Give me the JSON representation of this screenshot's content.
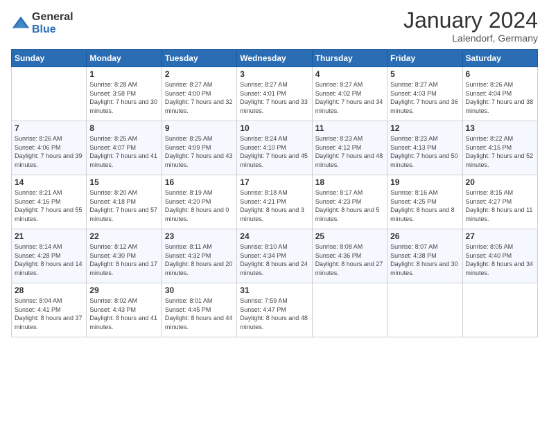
{
  "logo": {
    "general": "General",
    "blue": "Blue"
  },
  "header": {
    "month": "January 2024",
    "location": "Lalendorf, Germany"
  },
  "days_of_week": [
    "Sunday",
    "Monday",
    "Tuesday",
    "Wednesday",
    "Thursday",
    "Friday",
    "Saturday"
  ],
  "weeks": [
    [
      {
        "day": "",
        "sunrise": "",
        "sunset": "",
        "daylight": ""
      },
      {
        "day": "1",
        "sunrise": "Sunrise: 8:28 AM",
        "sunset": "Sunset: 3:58 PM",
        "daylight": "Daylight: 7 hours and 30 minutes."
      },
      {
        "day": "2",
        "sunrise": "Sunrise: 8:27 AM",
        "sunset": "Sunset: 4:00 PM",
        "daylight": "Daylight: 7 hours and 32 minutes."
      },
      {
        "day": "3",
        "sunrise": "Sunrise: 8:27 AM",
        "sunset": "Sunset: 4:01 PM",
        "daylight": "Daylight: 7 hours and 33 minutes."
      },
      {
        "day": "4",
        "sunrise": "Sunrise: 8:27 AM",
        "sunset": "Sunset: 4:02 PM",
        "daylight": "Daylight: 7 hours and 34 minutes."
      },
      {
        "day": "5",
        "sunrise": "Sunrise: 8:27 AM",
        "sunset": "Sunset: 4:03 PM",
        "daylight": "Daylight: 7 hours and 36 minutes."
      },
      {
        "day": "6",
        "sunrise": "Sunrise: 8:26 AM",
        "sunset": "Sunset: 4:04 PM",
        "daylight": "Daylight: 7 hours and 38 minutes."
      }
    ],
    [
      {
        "day": "7",
        "sunrise": "Sunrise: 8:26 AM",
        "sunset": "Sunset: 4:06 PM",
        "daylight": "Daylight: 7 hours and 39 minutes."
      },
      {
        "day": "8",
        "sunrise": "Sunrise: 8:25 AM",
        "sunset": "Sunset: 4:07 PM",
        "daylight": "Daylight: 7 hours and 41 minutes."
      },
      {
        "day": "9",
        "sunrise": "Sunrise: 8:25 AM",
        "sunset": "Sunset: 4:09 PM",
        "daylight": "Daylight: 7 hours and 43 minutes."
      },
      {
        "day": "10",
        "sunrise": "Sunrise: 8:24 AM",
        "sunset": "Sunset: 4:10 PM",
        "daylight": "Daylight: 7 hours and 45 minutes."
      },
      {
        "day": "11",
        "sunrise": "Sunrise: 8:23 AM",
        "sunset": "Sunset: 4:12 PM",
        "daylight": "Daylight: 7 hours and 48 minutes."
      },
      {
        "day": "12",
        "sunrise": "Sunrise: 8:23 AM",
        "sunset": "Sunset: 4:13 PM",
        "daylight": "Daylight: 7 hours and 50 minutes."
      },
      {
        "day": "13",
        "sunrise": "Sunrise: 8:22 AM",
        "sunset": "Sunset: 4:15 PM",
        "daylight": "Daylight: 7 hours and 52 minutes."
      }
    ],
    [
      {
        "day": "14",
        "sunrise": "Sunrise: 8:21 AM",
        "sunset": "Sunset: 4:16 PM",
        "daylight": "Daylight: 7 hours and 55 minutes."
      },
      {
        "day": "15",
        "sunrise": "Sunrise: 8:20 AM",
        "sunset": "Sunset: 4:18 PM",
        "daylight": "Daylight: 7 hours and 57 minutes."
      },
      {
        "day": "16",
        "sunrise": "Sunrise: 8:19 AM",
        "sunset": "Sunset: 4:20 PM",
        "daylight": "Daylight: 8 hours and 0 minutes."
      },
      {
        "day": "17",
        "sunrise": "Sunrise: 8:18 AM",
        "sunset": "Sunset: 4:21 PM",
        "daylight": "Daylight: 8 hours and 3 minutes."
      },
      {
        "day": "18",
        "sunrise": "Sunrise: 8:17 AM",
        "sunset": "Sunset: 4:23 PM",
        "daylight": "Daylight: 8 hours and 5 minutes."
      },
      {
        "day": "19",
        "sunrise": "Sunrise: 8:16 AM",
        "sunset": "Sunset: 4:25 PM",
        "daylight": "Daylight: 8 hours and 8 minutes."
      },
      {
        "day": "20",
        "sunrise": "Sunrise: 8:15 AM",
        "sunset": "Sunset: 4:27 PM",
        "daylight": "Daylight: 8 hours and 11 minutes."
      }
    ],
    [
      {
        "day": "21",
        "sunrise": "Sunrise: 8:14 AM",
        "sunset": "Sunset: 4:28 PM",
        "daylight": "Daylight: 8 hours and 14 minutes."
      },
      {
        "day": "22",
        "sunrise": "Sunrise: 8:12 AM",
        "sunset": "Sunset: 4:30 PM",
        "daylight": "Daylight: 8 hours and 17 minutes."
      },
      {
        "day": "23",
        "sunrise": "Sunrise: 8:11 AM",
        "sunset": "Sunset: 4:32 PM",
        "daylight": "Daylight: 8 hours and 20 minutes."
      },
      {
        "day": "24",
        "sunrise": "Sunrise: 8:10 AM",
        "sunset": "Sunset: 4:34 PM",
        "daylight": "Daylight: 8 hours and 24 minutes."
      },
      {
        "day": "25",
        "sunrise": "Sunrise: 8:08 AM",
        "sunset": "Sunset: 4:36 PM",
        "daylight": "Daylight: 8 hours and 27 minutes."
      },
      {
        "day": "26",
        "sunrise": "Sunrise: 8:07 AM",
        "sunset": "Sunset: 4:38 PM",
        "daylight": "Daylight: 8 hours and 30 minutes."
      },
      {
        "day": "27",
        "sunrise": "Sunrise: 8:05 AM",
        "sunset": "Sunset: 4:40 PM",
        "daylight": "Daylight: 8 hours and 34 minutes."
      }
    ],
    [
      {
        "day": "28",
        "sunrise": "Sunrise: 8:04 AM",
        "sunset": "Sunset: 4:41 PM",
        "daylight": "Daylight: 8 hours and 37 minutes."
      },
      {
        "day": "29",
        "sunrise": "Sunrise: 8:02 AM",
        "sunset": "Sunset: 4:43 PM",
        "daylight": "Daylight: 8 hours and 41 minutes."
      },
      {
        "day": "30",
        "sunrise": "Sunrise: 8:01 AM",
        "sunset": "Sunset: 4:45 PM",
        "daylight": "Daylight: 8 hours and 44 minutes."
      },
      {
        "day": "31",
        "sunrise": "Sunrise: 7:59 AM",
        "sunset": "Sunset: 4:47 PM",
        "daylight": "Daylight: 8 hours and 48 minutes."
      },
      {
        "day": "",
        "sunrise": "",
        "sunset": "",
        "daylight": ""
      },
      {
        "day": "",
        "sunrise": "",
        "sunset": "",
        "daylight": ""
      },
      {
        "day": "",
        "sunrise": "",
        "sunset": "",
        "daylight": ""
      }
    ]
  ]
}
